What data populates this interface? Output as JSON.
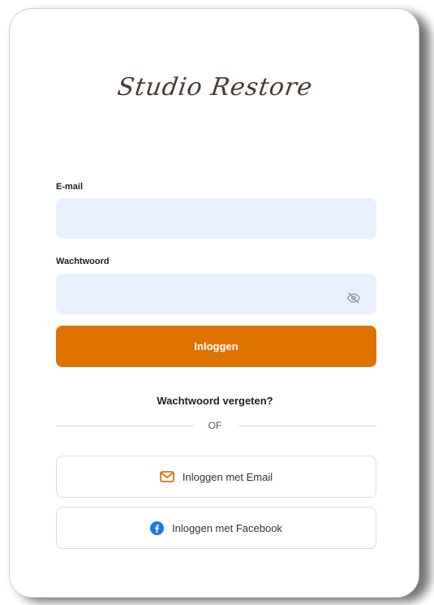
{
  "brand": {
    "logo_text": "Studio Restore"
  },
  "form": {
    "email_label": "E-mail",
    "email_value": "",
    "password_label": "Wachtwoord",
    "password_value": "",
    "login_button": "Inloggen",
    "forgot_password": "Wachtwoord vergeten?",
    "divider_text": "OF"
  },
  "social": {
    "email_login": "Inloggen met Email",
    "facebook_login": "Inloggen met Facebook"
  },
  "icons": {
    "password_toggle": "eye-slash-icon",
    "email": "envelope-icon",
    "facebook": "facebook-icon"
  },
  "colors": {
    "primary": "#e07200",
    "field_bg": "#e8f0fd",
    "facebook": "#1877f2",
    "email_icon": "#e07200"
  }
}
